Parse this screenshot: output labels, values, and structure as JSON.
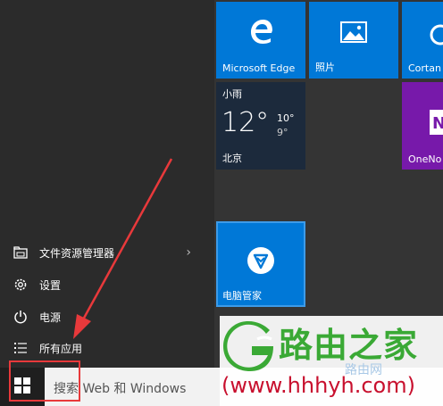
{
  "menu": {
    "file_explorer": "文件资源管理器",
    "settings": "设置",
    "power": "电源",
    "all_apps": "所有应用",
    "chevron": "›"
  },
  "tiles": {
    "edge": "Microsoft Edge",
    "photos": "照片",
    "cortana": "Cortan",
    "onenote": "OneNo",
    "pc_manager": "电脑管家"
  },
  "weather": {
    "condition": "小雨",
    "temp": "12°",
    "high": "10°",
    "low": "9°",
    "city": "北京"
  },
  "taskbar": {
    "search_placeholder": "搜索 Web 和 Windows"
  },
  "watermark": {
    "brand": "路由之家",
    "url": "(www.hhhyh.com)",
    "small": "路由网"
  },
  "colors": {
    "tile_blue": "#0078d7",
    "onenote_purple": "#7719aa",
    "weather_tile": "#1c2a3c",
    "annotation_red": "#e8393b"
  }
}
